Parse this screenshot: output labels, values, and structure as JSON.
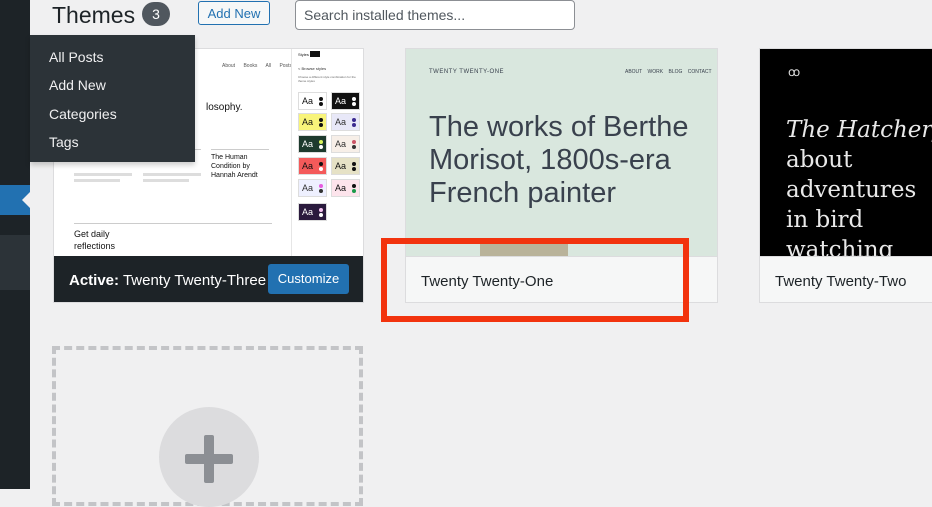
{
  "header": {
    "title": "Themes",
    "count": "3",
    "add_new_label": "Add New",
    "search_placeholder": "Search installed themes..."
  },
  "flyout_menu": {
    "items": [
      {
        "label": "All Posts"
      },
      {
        "label": "Add New"
      },
      {
        "label": "Categories"
      },
      {
        "label": "Tags"
      }
    ]
  },
  "themes": {
    "twenty_twenty_three": {
      "active_prefix": "Active:",
      "name": "Twenty Twenty-Three",
      "customize_label": "Customize",
      "preview": {
        "nav": [
          "About",
          "Books",
          "All Posts"
        ],
        "heading": "losophy.",
        "book_title": "The Human Condition by Hannah Arendt",
        "get_text": "Get daily reflections",
        "panel_title": "Styles",
        "panel_back": "< Browse styles",
        "panel_desc": "Choose a different style combination for the theme styles",
        "swatch_label": "Aa"
      }
    },
    "twenty_twenty_one": {
      "name": "Twenty Twenty-One",
      "preview": {
        "site_title": "TWENTY TWENTY-ONE",
        "nav": [
          "ABOUT",
          "WORK",
          "BLOG",
          "CONTACT"
        ],
        "heading": "The works of Berthe Morisot, 1800s-era French painter"
      }
    },
    "twenty_twenty_two": {
      "name": "Twenty Twenty-Two",
      "preview": {
        "logo": "ꝏ",
        "heading_italic": "The Hatchery:",
        "heading_rest": "about adventures in bird watching"
      }
    }
  },
  "colors": {
    "admin_bar": "#1d2327",
    "accent_blue": "#2271b1",
    "highlight_red": "#f2330e",
    "tt1_background": "#d9e7de"
  },
  "icons": {
    "add_theme": "plus-icon"
  }
}
